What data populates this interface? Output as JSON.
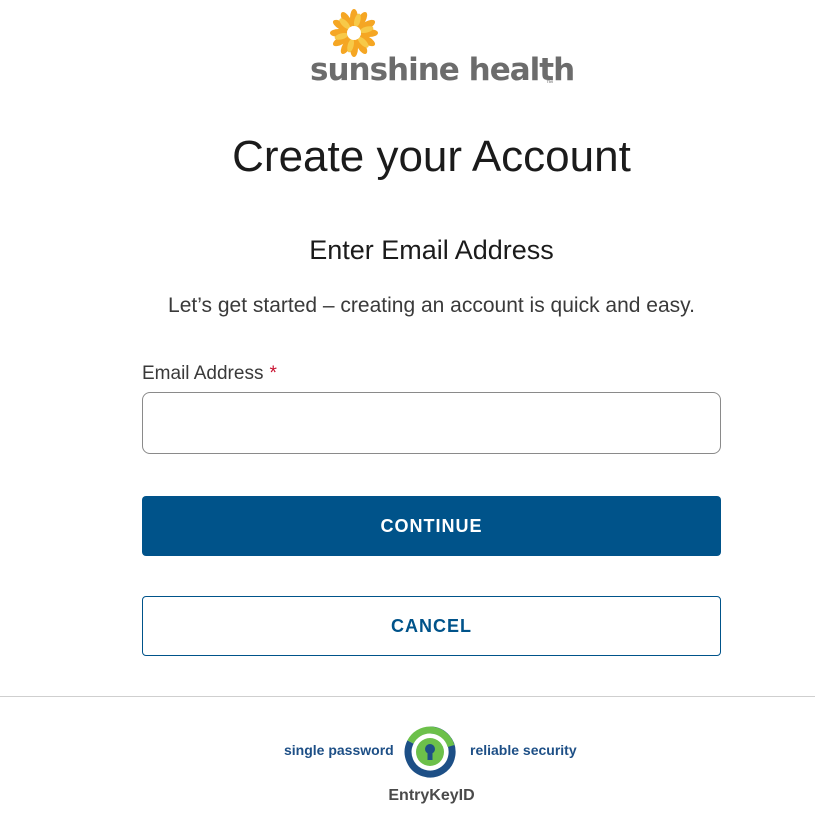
{
  "logo": {
    "brand_text": "sunshine health",
    "tm": "™",
    "icon": "sunflower-logo-icon",
    "colors": {
      "petal_primary": "#f5a623",
      "petal_secondary": "#f7c948",
      "text": "#6c6c6c"
    }
  },
  "heading": {
    "title": "Create your Account",
    "subtitle": "Enter Email Address",
    "lead": "Let’s get started – creating an account is quick and easy."
  },
  "form": {
    "email_label": "Email Address",
    "required_marker": "*",
    "email_value": "",
    "email_placeholder": ""
  },
  "buttons": {
    "continue_label": "CONTINUE",
    "cancel_label": "CANCEL"
  },
  "footer": {
    "left_text": "single password",
    "right_text": "reliable security",
    "brand": "EntryKeyID",
    "icon": "entrykey-lock-icon"
  },
  "colors": {
    "primary": "#00538a",
    "required": "#c8102e",
    "footer_blue": "#1d4f86",
    "ek_green": "#6cc04a",
    "ek_blue": "#1d4f86"
  }
}
